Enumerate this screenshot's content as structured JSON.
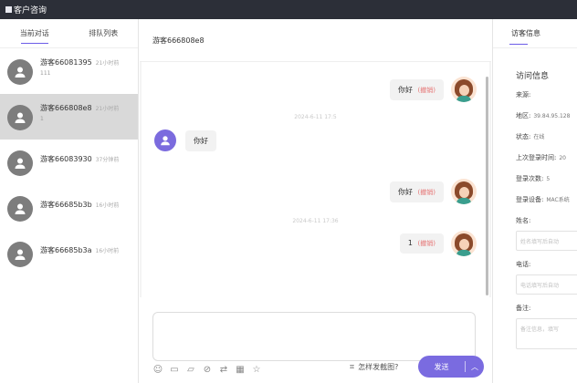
{
  "window": {
    "title": "客户咨询"
  },
  "sidebar": {
    "tabs": [
      {
        "label": "当前对话"
      },
      {
        "label": "排队列表"
      }
    ],
    "conversations": [
      {
        "name": "游客66081395",
        "time": "21小时前",
        "preview": "111"
      },
      {
        "name": "游客666808e8",
        "time": "21小时前",
        "preview": "1"
      },
      {
        "name": "游客66083930",
        "time": "37分钟前",
        "preview": ""
      },
      {
        "name": "游客66685b3b",
        "time": "16小时前",
        "preview": ""
      },
      {
        "name": "游客66685b3a",
        "time": "16小时前",
        "preview": ""
      }
    ]
  },
  "chat": {
    "header": "游客666808e8",
    "messages": [
      {
        "side": "agent",
        "text": "你好",
        "recall": "(撤销)"
      },
      {
        "type": "time",
        "text": "2024-6-11 17:5"
      },
      {
        "side": "guest",
        "text": "你好"
      },
      {
        "side": "agent",
        "text": "你好",
        "recall": "(撤销)"
      },
      {
        "type": "time",
        "text": "2024-6-11 17:36"
      },
      {
        "side": "agent",
        "text": "1",
        "recall": "(撤销)"
      }
    ],
    "composer": {
      "howto_label": "怎样发截图?",
      "send_label": "发送",
      "tools": [
        "emoji-icon",
        "image-icon",
        "folder-icon",
        "block-icon",
        "transfer-icon",
        "screenshot-icon",
        "star-icon"
      ]
    }
  },
  "visitor": {
    "tabs": [
      {
        "label": "访客信息"
      }
    ],
    "section_title": "访问信息",
    "rows": [
      {
        "label": "来源:",
        "value": ""
      },
      {
        "label": "地区:",
        "value": "39.84.95.128"
      },
      {
        "label": "状态:",
        "value": "在线"
      },
      {
        "label": "上次登录时间:",
        "value": "20"
      },
      {
        "label": "登录次数:",
        "value": "5"
      },
      {
        "label": "登录设备:",
        "value": "MAC系统"
      }
    ],
    "fields": [
      {
        "label": "姓名:",
        "placeholder": "姓名填写后自动"
      },
      {
        "label": "电话:",
        "placeholder": "电话填写后自动"
      },
      {
        "label": "备注:",
        "placeholder": "备注信息，填写"
      }
    ]
  },
  "colors": {
    "accent": "#7a6be0",
    "titlebar": "#2c2f38",
    "recall": "#e57373"
  }
}
